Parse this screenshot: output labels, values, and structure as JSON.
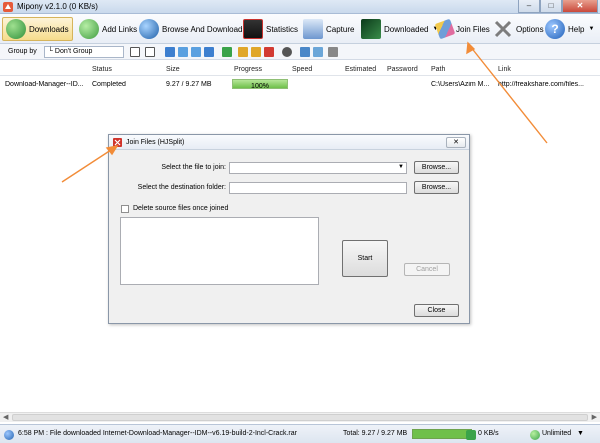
{
  "window": {
    "title": "Mipony v2.1.0 (0 KB/s)",
    "controls": [
      "–",
      "□",
      "✕"
    ]
  },
  "toolbar": {
    "items": [
      {
        "label": "Downloads",
        "icon": "downloads-icon",
        "color": "#3aa34a"
      },
      {
        "label": "Add Links",
        "icon": "add-links-icon",
        "color": "#45a845"
      },
      {
        "label": "Browse And Download",
        "icon": "globe-icon",
        "color": "#2f78c4"
      },
      {
        "label": "Statistics",
        "icon": "statistics-icon",
        "color": "#c8322e"
      },
      {
        "label": "Capture",
        "icon": "capture-icon",
        "color": "#3a6fb7"
      },
      {
        "label": "Downloaded",
        "icon": "downloaded-icon",
        "color": "#2c6e2c"
      },
      {
        "label": "Join Files",
        "icon": "join-files-icon",
        "color": "#6f9ed8"
      },
      {
        "label": "Options",
        "icon": "options-icon",
        "color": "#8a8a8a"
      },
      {
        "label": "Help",
        "icon": "help-icon",
        "color": "#2f6fc4"
      }
    ]
  },
  "toolbar2": {
    "group_by_label": "Group by",
    "group_by_value": "└ Don't Group"
  },
  "grid": {
    "columns": [
      "Status",
      "Size",
      "Progress",
      "Speed",
      "Estimated",
      "Password",
      "Path",
      "Link"
    ],
    "rows": [
      {
        "name": "Download-Manager--ID...",
        "status": "Completed",
        "size": "9.27 / 9.27 MB",
        "progress_text": "100%",
        "progress": 1.0,
        "speed": "",
        "estimated": "",
        "password": "",
        "path": "C:\\Users\\Azim M...",
        "link": "http://freakshare.com/files..."
      }
    ]
  },
  "dialog": {
    "title": "Join Files (HJSplit)",
    "file_label": "Select the file to join:",
    "file_value": "",
    "dest_label": "Select the destination folder:",
    "dest_value": "",
    "browse_label": "Browse...",
    "delete_label": "Delete source files once joined",
    "start_label": "Start",
    "cancel_label": "Cancel",
    "close_label": "Close",
    "title_close": "✕"
  },
  "statusbar": {
    "message": "6:58 PM : File downloaded Internet-Download-Manager--IDM--v6.19-build-2-Incl-Crack.rar",
    "total": "Total: 9.27 / 9.27 MB",
    "speed": "0 KB/s",
    "limit": "Unlimited"
  },
  "colors": {
    "accent": "#f28c38",
    "progress_green": "#6fc04a"
  }
}
